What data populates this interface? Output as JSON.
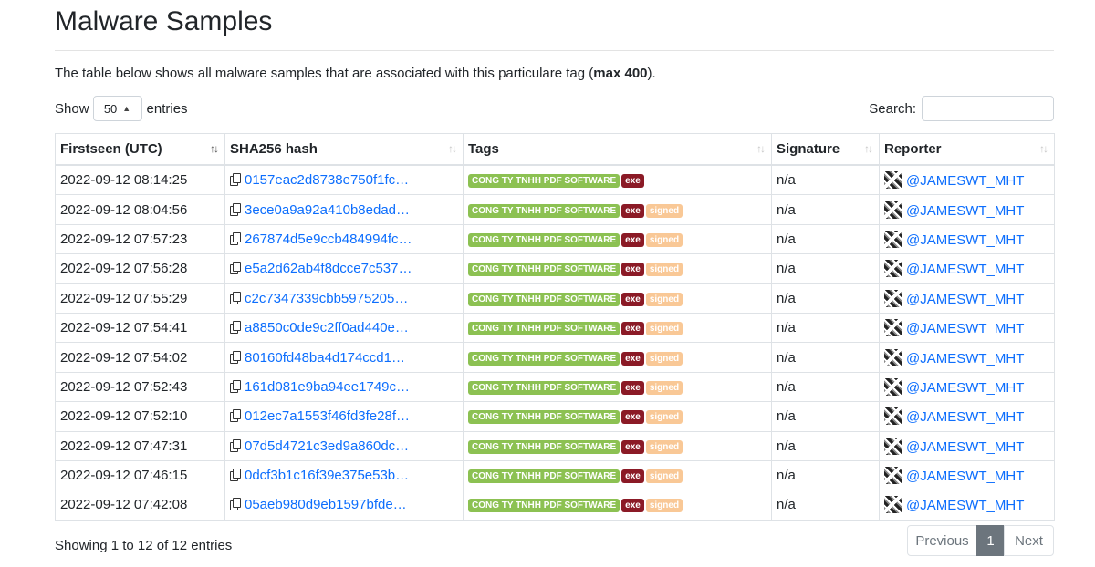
{
  "page": {
    "title": "Malware Samples",
    "intro_prefix": "The table below shows all malware samples that are associated with this particulare tag (",
    "intro_bold": "max 400",
    "intro_suffix": ")."
  },
  "controls": {
    "show_label": "Show",
    "entries_value": "50",
    "entries_label": "entries",
    "search_label": "Search:",
    "search_value": ""
  },
  "table": {
    "columns": [
      "Firstseen (UTC)",
      "SHA256 hash",
      "Tags",
      "Signature",
      "Reporter"
    ],
    "tag_labels": {
      "vendor": "CONG TY TNHH PDF SOFTWARE",
      "exe": "exe",
      "signed": "signed"
    },
    "colors": {
      "vendor": "#8cc152",
      "exe": "#8b1a26",
      "signed": "#f9c896",
      "link": "#0d6efd"
    },
    "rows": [
      {
        "firstseen": "2022-09-12 08:14:25",
        "hash": "0157eac2d8738e750f1fc…",
        "tags": [
          "vendor",
          "exe"
        ],
        "signature": "n/a",
        "reporter": "@JAMESWT_MHT"
      },
      {
        "firstseen": "2022-09-12 08:04:56",
        "hash": "3ece0a9a92a410b8edad…",
        "tags": [
          "vendor",
          "exe",
          "signed"
        ],
        "signature": "n/a",
        "reporter": "@JAMESWT_MHT"
      },
      {
        "firstseen": "2022-09-12 07:57:23",
        "hash": "267874d5e9ccb484994fc…",
        "tags": [
          "vendor",
          "exe",
          "signed"
        ],
        "signature": "n/a",
        "reporter": "@JAMESWT_MHT"
      },
      {
        "firstseen": "2022-09-12 07:56:28",
        "hash": "e5a2d62ab4f8dcce7c537…",
        "tags": [
          "vendor",
          "exe",
          "signed"
        ],
        "signature": "n/a",
        "reporter": "@JAMESWT_MHT"
      },
      {
        "firstseen": "2022-09-12 07:55:29",
        "hash": "c2c7347339cbb5975205…",
        "tags": [
          "vendor",
          "exe",
          "signed"
        ],
        "signature": "n/a",
        "reporter": "@JAMESWT_MHT"
      },
      {
        "firstseen": "2022-09-12 07:54:41",
        "hash": "a8850c0de9c2ff0ad440e…",
        "tags": [
          "vendor",
          "exe",
          "signed"
        ],
        "signature": "n/a",
        "reporter": "@JAMESWT_MHT"
      },
      {
        "firstseen": "2022-09-12 07:54:02",
        "hash": "80160fd48ba4d174ccd1…",
        "tags": [
          "vendor",
          "exe",
          "signed"
        ],
        "signature": "n/a",
        "reporter": "@JAMESWT_MHT"
      },
      {
        "firstseen": "2022-09-12 07:52:43",
        "hash": "161d081e9ba94ee1749c…",
        "tags": [
          "vendor",
          "exe",
          "signed"
        ],
        "signature": "n/a",
        "reporter": "@JAMESWT_MHT"
      },
      {
        "firstseen": "2022-09-12 07:52:10",
        "hash": "012ec7a1553f46fd3fe28f…",
        "tags": [
          "vendor",
          "exe",
          "signed"
        ],
        "signature": "n/a",
        "reporter": "@JAMESWT_MHT"
      },
      {
        "firstseen": "2022-09-12 07:47:31",
        "hash": "07d5d4721c3ed9a860dc…",
        "tags": [
          "vendor",
          "exe",
          "signed"
        ],
        "signature": "n/a",
        "reporter": "@JAMESWT_MHT"
      },
      {
        "firstseen": "2022-09-12 07:46:15",
        "hash": "0dcf3b1c16f39e375e53b…",
        "tags": [
          "vendor",
          "exe",
          "signed"
        ],
        "signature": "n/a",
        "reporter": "@JAMESWT_MHT"
      },
      {
        "firstseen": "2022-09-12 07:42:08",
        "hash": "05aeb980d9eb1597bfde…",
        "tags": [
          "vendor",
          "exe",
          "signed"
        ],
        "signature": "n/a",
        "reporter": "@JAMESWT_MHT"
      }
    ]
  },
  "footer": {
    "info": "Showing 1 to 12 of 12 entries",
    "previous": "Previous",
    "current_page": "1",
    "next": "Next"
  }
}
